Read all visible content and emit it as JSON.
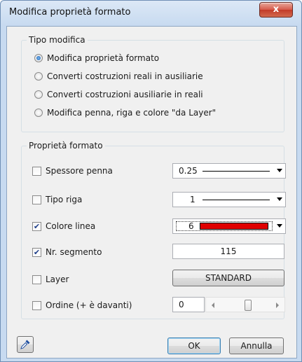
{
  "window": {
    "title": "Modifica proprietà formato",
    "close_glyph": "x"
  },
  "tipo_modifica": {
    "legend": "Tipo modifica",
    "options": [
      {
        "label": "Modifica proprietà formato",
        "checked": true
      },
      {
        "label": "Converti costruzioni reali in ausiliarie",
        "checked": false
      },
      {
        "label": "Converti costruzioni ausiliarie in reali",
        "checked": false
      },
      {
        "label": "Modifica penna, riga e colore \"da Layer\"",
        "checked": false
      }
    ]
  },
  "proprieta": {
    "legend": "Proprietà formato",
    "spessore": {
      "label": "Spessore penna",
      "checked": false,
      "value": "0.25"
    },
    "tipo_riga": {
      "label": "Tipo riga",
      "checked": false,
      "value": "1"
    },
    "colore": {
      "label": "Colore linea",
      "checked": true,
      "value": "6",
      "swatch": "#e00000"
    },
    "segmento": {
      "label": "Nr. segmento",
      "checked": true,
      "value": "115"
    },
    "layer": {
      "label": "Layer",
      "checked": false,
      "value": "STANDARD"
    },
    "ordine": {
      "label": "Ordine (+ è davanti)",
      "checked": false,
      "value": "0",
      "slider_fraction": 0.55
    }
  },
  "footer": {
    "pipette_icon": "eyedropper-icon",
    "ok_label": "OK",
    "cancel_label": "Annulla"
  }
}
